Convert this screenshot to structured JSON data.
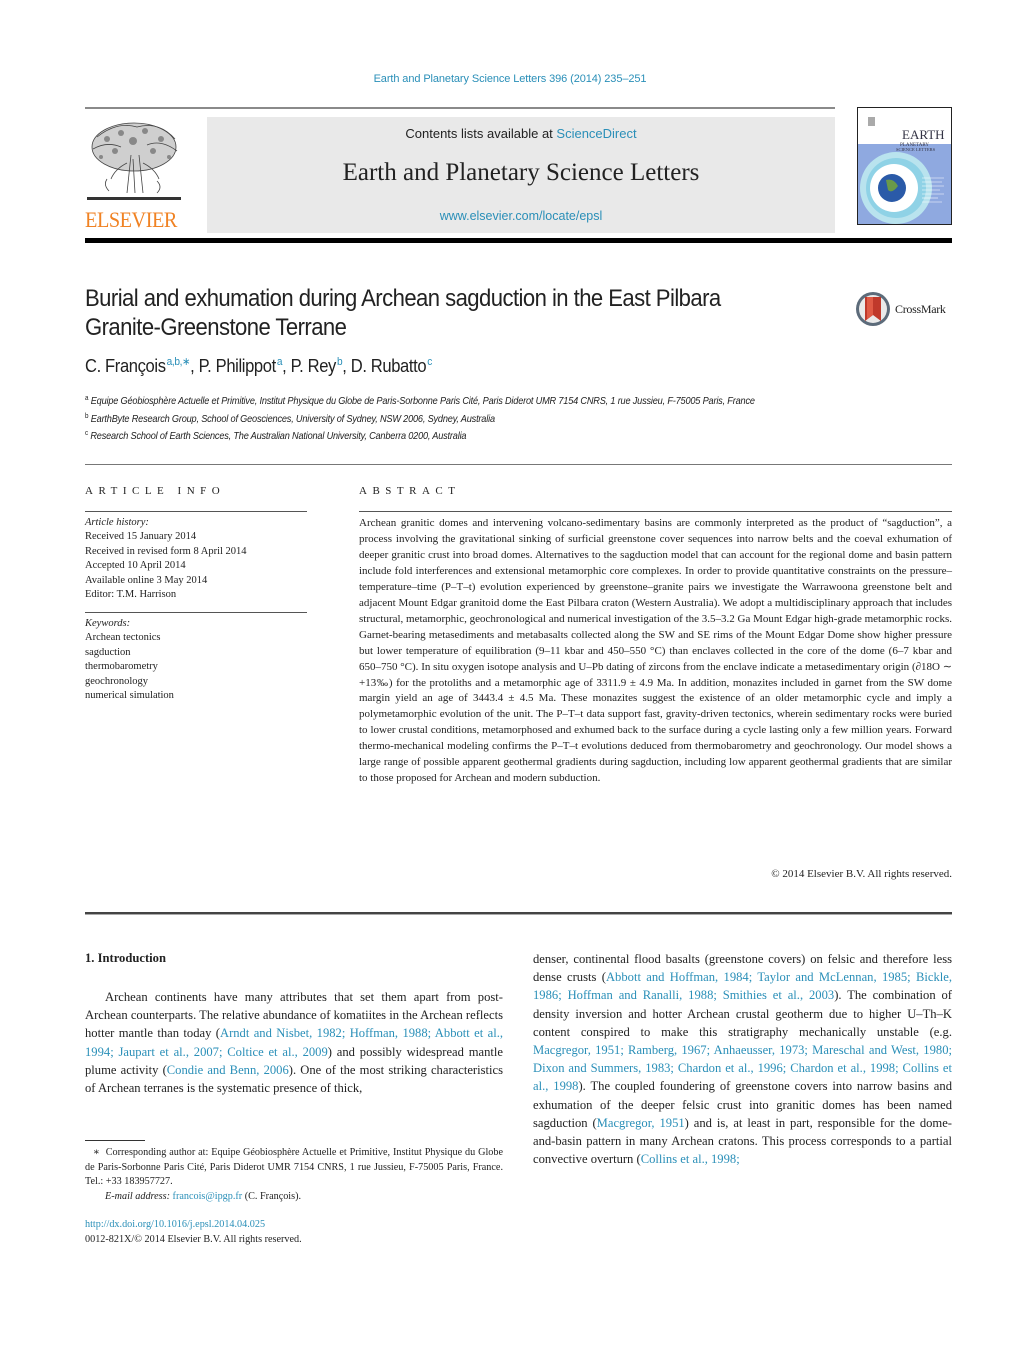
{
  "journal_ref": "Earth and Planetary Science Letters 396 (2014) 235–251",
  "header": {
    "publisher": "ELSEVIER",
    "contents_prefix": "Contents lists available at ",
    "contents_link": "ScienceDirect",
    "journal_name": "Earth and Planetary Science Letters",
    "journal_url": "www.elsevier.com/locate/epsl",
    "cover_title_1": "EARTH",
    "cover_title_2": "PLANETARY",
    "cover_title_3": "SCIENCE LETTERS"
  },
  "title": "Burial and exhumation during Archean sagduction in the East Pilbara Granite-Greenstone Terrane",
  "crossmark_label": "CrossMark",
  "authors": [
    {
      "name": "C. François",
      "sup": "a,b,∗"
    },
    {
      "name": "P. Philippot",
      "sup": "a"
    },
    {
      "name": "P. Rey",
      "sup": "b"
    },
    {
      "name": "D. Rubatto",
      "sup": "c"
    }
  ],
  "author_sep": ", ",
  "affiliations": [
    {
      "key": "a",
      "text": "Equipe Géobiosphère Actuelle et Primitive, Institut Physique du Globe de Paris-Sorbonne Paris Cité, Paris Diderot UMR 7154 CNRS, 1 rue Jussieu, F-75005 Paris, France"
    },
    {
      "key": "b",
      "text": "EarthByte Research Group, School of Geosciences, University of Sydney, NSW 2006, Sydney, Australia"
    },
    {
      "key": "c",
      "text": "Research School of Earth Sciences, The Australian National University, Canberra 0200, Australia"
    }
  ],
  "article_info": {
    "heading": "ARTICLE INFO",
    "history_label": "Article history:",
    "history": [
      "Received 15 January 2014",
      "Received in revised form 8 April 2014",
      "Accepted 10 April 2014",
      "Available online 3 May 2014",
      "Editor: T.M. Harrison"
    ],
    "keywords_label": "Keywords:",
    "keywords": [
      "Archean tectonics",
      "sagduction",
      "thermobarometry",
      "geochronology",
      "numerical simulation"
    ]
  },
  "abstract": {
    "heading": "ABSTRACT",
    "text": "Archean granitic domes and intervening volcano-sedimentary basins are commonly interpreted as the product of “sagduction”, a process involving the gravitational sinking of surficial greenstone cover sequences into narrow belts and the coeval exhumation of deeper granitic crust into broad domes. Alternatives to the sagduction model that can account for the regional dome and basin pattern include fold interferences and extensional metamorphic core complexes. In order to provide quantitative constraints on the pressure–temperature–time (P–T–t) evolution experienced by greenstone–granite pairs we investigate the Warrawoona greenstone belt and adjacent Mount Edgar granitoid dome the East Pilbara craton (Western Australia). We adopt a multidisciplinary approach that includes structural, metamorphic, geochronological and numerical investigation of the 3.5–3.2 Ga Mount Edgar high-grade metamorphic rocks. Garnet-bearing metasediments and metabasalts collected along the SW and SE rims of the Mount Edgar Dome show higher pressure but lower temperature of equilibration (9–11 kbar and 450–550 °C) than enclaves collected in the core of the dome (6–7 kbar and 650–750 °C). In situ oxygen isotope analysis and U–Pb dating of zircons from the enclave indicate a metasedimentary origin (∂18O ∼ +13‰) for the protoliths and a metamorphic age of 3311.9 ± 4.9 Ma. In addition, monazites included in garnet from the SW dome margin yield an age of 3443.4 ± 4.5 Ma. These monazites suggest the existence of an older metamorphic cycle and imply a polymetamorphic evolution of the unit. The P–T–t data support fast, gravity-driven tectonics, wherein sedimentary rocks were buried to lower crustal conditions, metamorphosed and exhumed back to the surface during a cycle lasting only a few million years. Forward thermo-mechanical modeling confirms the P–T–t evolutions deduced from thermobarometry and geochronology. Our model shows a large range of possible apparent geothermal gradients during sagduction, including low apparent geothermal gradients that are similar to those proposed for Archean and modern subduction.",
    "copyright": "© 2014 Elsevier B.V. All rights reserved."
  },
  "intro": {
    "heading": "1. Introduction",
    "left_segments": [
      {
        "t": "Archean continents have many attributes that set them apart from post-Archean counterparts. The relative abundance of komatiites in the Archean reflects hotter mantle than today (",
        "link": false
      },
      {
        "t": "Arndt and Nisbet, 1982; Hoffman, 1988; Abbott et al., 1994; Jaupart et al., 2007; Coltice et al., 2009",
        "link": true
      },
      {
        "t": ") and possibly widespread mantle plume activity (",
        "link": false
      },
      {
        "t": "Condie and Benn, 2006",
        "link": true
      },
      {
        "t": "). One of the most striking characteristics of Archean terranes is the systematic presence of thick,",
        "link": false
      }
    ],
    "right_segments": [
      {
        "t": "denser, continental flood basalts (greenstone covers) on felsic and therefore less dense crusts (",
        "link": false
      },
      {
        "t": "Abbott and Hoffman, 1984; Taylor and McLennan, 1985; Bickle, 1986; Hoffman and Ranalli, 1988; Smithies et al., 2003",
        "link": true
      },
      {
        "t": "). The combination of density inversion and hotter Archean crustal geotherm due to higher U–Th–K content conspired to make this stratigraphy mechanically unstable (e.g. ",
        "link": false
      },
      {
        "t": "Macgregor, 1951; Ramberg, 1967; Anhaeusser, 1973; Mareschal and West, 1980; Dixon and Summers, 1983; Chardon et al., 1996; Chardon et al., 1998; Collins et al., 1998",
        "link": true
      },
      {
        "t": "). The coupled foundering of greenstone covers into narrow basins and exhumation of the deeper felsic crust into granitic domes has been named sagduction (",
        "link": false
      },
      {
        "t": "Macgregor, 1951",
        "link": true
      },
      {
        "t": ") and is, at least in part, responsible for the dome-and-basin pattern in many Archean cratons. This process corresponds to a partial convective overturn (",
        "link": false
      },
      {
        "t": "Collins et al., 1998;",
        "link": true
      }
    ]
  },
  "footnote": {
    "star": "∗",
    "text": "Corresponding author at: Equipe Géobiosphère Actuelle et Primitive, Institut Physique du Globe de Paris-Sorbonne Paris Cité, Paris Diderot UMR 7154 CNRS, 1 rue Jussieu, F-75005 Paris, France. Tel.: +33 183957727.",
    "email_label": "E-mail address: ",
    "email": "francois@ipgp.fr",
    "email_suffix": " (C. François)."
  },
  "footer": {
    "doi": "http://dx.doi.org/10.1016/j.epsl.2014.04.025",
    "issn": "0012-821X/© 2014 Elsevier B.V. All rights reserved."
  },
  "colors": {
    "link": "#2a8fb8",
    "elsevier_orange": "#f08223",
    "header_grey": "#e9e9e9"
  }
}
